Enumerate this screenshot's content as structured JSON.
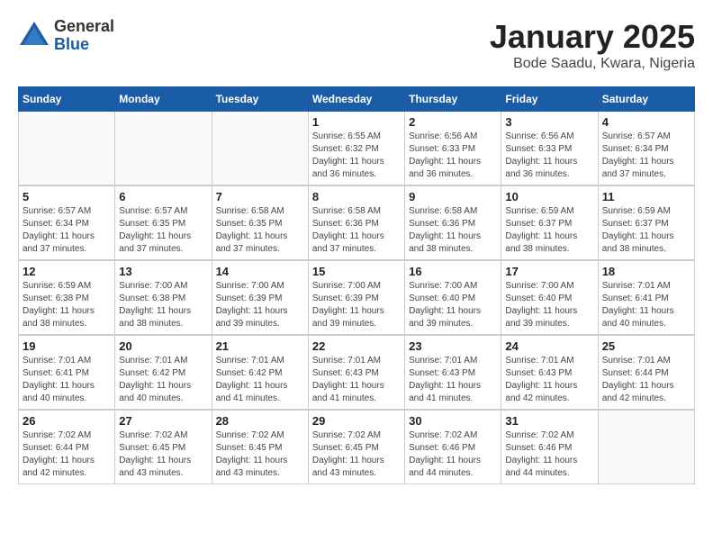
{
  "logo": {
    "general": "General",
    "blue": "Blue"
  },
  "title": "January 2025",
  "location": "Bode Saadu, Kwara, Nigeria",
  "days_of_week": [
    "Sunday",
    "Monday",
    "Tuesday",
    "Wednesday",
    "Thursday",
    "Friday",
    "Saturday"
  ],
  "weeks": [
    [
      {
        "day": "",
        "info": ""
      },
      {
        "day": "",
        "info": ""
      },
      {
        "day": "",
        "info": ""
      },
      {
        "day": "1",
        "info": "Sunrise: 6:55 AM\nSunset: 6:32 PM\nDaylight: 11 hours and 36 minutes."
      },
      {
        "day": "2",
        "info": "Sunrise: 6:56 AM\nSunset: 6:33 PM\nDaylight: 11 hours and 36 minutes."
      },
      {
        "day": "3",
        "info": "Sunrise: 6:56 AM\nSunset: 6:33 PM\nDaylight: 11 hours and 36 minutes."
      },
      {
        "day": "4",
        "info": "Sunrise: 6:57 AM\nSunset: 6:34 PM\nDaylight: 11 hours and 37 minutes."
      }
    ],
    [
      {
        "day": "5",
        "info": "Sunrise: 6:57 AM\nSunset: 6:34 PM\nDaylight: 11 hours and 37 minutes."
      },
      {
        "day": "6",
        "info": "Sunrise: 6:57 AM\nSunset: 6:35 PM\nDaylight: 11 hours and 37 minutes."
      },
      {
        "day": "7",
        "info": "Sunrise: 6:58 AM\nSunset: 6:35 PM\nDaylight: 11 hours and 37 minutes."
      },
      {
        "day": "8",
        "info": "Sunrise: 6:58 AM\nSunset: 6:36 PM\nDaylight: 11 hours and 37 minutes."
      },
      {
        "day": "9",
        "info": "Sunrise: 6:58 AM\nSunset: 6:36 PM\nDaylight: 11 hours and 38 minutes."
      },
      {
        "day": "10",
        "info": "Sunrise: 6:59 AM\nSunset: 6:37 PM\nDaylight: 11 hours and 38 minutes."
      },
      {
        "day": "11",
        "info": "Sunrise: 6:59 AM\nSunset: 6:37 PM\nDaylight: 11 hours and 38 minutes."
      }
    ],
    [
      {
        "day": "12",
        "info": "Sunrise: 6:59 AM\nSunset: 6:38 PM\nDaylight: 11 hours and 38 minutes."
      },
      {
        "day": "13",
        "info": "Sunrise: 7:00 AM\nSunset: 6:38 PM\nDaylight: 11 hours and 38 minutes."
      },
      {
        "day": "14",
        "info": "Sunrise: 7:00 AM\nSunset: 6:39 PM\nDaylight: 11 hours and 39 minutes."
      },
      {
        "day": "15",
        "info": "Sunrise: 7:00 AM\nSunset: 6:39 PM\nDaylight: 11 hours and 39 minutes."
      },
      {
        "day": "16",
        "info": "Sunrise: 7:00 AM\nSunset: 6:40 PM\nDaylight: 11 hours and 39 minutes."
      },
      {
        "day": "17",
        "info": "Sunrise: 7:00 AM\nSunset: 6:40 PM\nDaylight: 11 hours and 39 minutes."
      },
      {
        "day": "18",
        "info": "Sunrise: 7:01 AM\nSunset: 6:41 PM\nDaylight: 11 hours and 40 minutes."
      }
    ],
    [
      {
        "day": "19",
        "info": "Sunrise: 7:01 AM\nSunset: 6:41 PM\nDaylight: 11 hours and 40 minutes."
      },
      {
        "day": "20",
        "info": "Sunrise: 7:01 AM\nSunset: 6:42 PM\nDaylight: 11 hours and 40 minutes."
      },
      {
        "day": "21",
        "info": "Sunrise: 7:01 AM\nSunset: 6:42 PM\nDaylight: 11 hours and 41 minutes."
      },
      {
        "day": "22",
        "info": "Sunrise: 7:01 AM\nSunset: 6:43 PM\nDaylight: 11 hours and 41 minutes."
      },
      {
        "day": "23",
        "info": "Sunrise: 7:01 AM\nSunset: 6:43 PM\nDaylight: 11 hours and 41 minutes."
      },
      {
        "day": "24",
        "info": "Sunrise: 7:01 AM\nSunset: 6:43 PM\nDaylight: 11 hours and 42 minutes."
      },
      {
        "day": "25",
        "info": "Sunrise: 7:01 AM\nSunset: 6:44 PM\nDaylight: 11 hours and 42 minutes."
      }
    ],
    [
      {
        "day": "26",
        "info": "Sunrise: 7:02 AM\nSunset: 6:44 PM\nDaylight: 11 hours and 42 minutes."
      },
      {
        "day": "27",
        "info": "Sunrise: 7:02 AM\nSunset: 6:45 PM\nDaylight: 11 hours and 43 minutes."
      },
      {
        "day": "28",
        "info": "Sunrise: 7:02 AM\nSunset: 6:45 PM\nDaylight: 11 hours and 43 minutes."
      },
      {
        "day": "29",
        "info": "Sunrise: 7:02 AM\nSunset: 6:45 PM\nDaylight: 11 hours and 43 minutes."
      },
      {
        "day": "30",
        "info": "Sunrise: 7:02 AM\nSunset: 6:46 PM\nDaylight: 11 hours and 44 minutes."
      },
      {
        "day": "31",
        "info": "Sunrise: 7:02 AM\nSunset: 6:46 PM\nDaylight: 11 hours and 44 minutes."
      },
      {
        "day": "",
        "info": ""
      }
    ]
  ]
}
